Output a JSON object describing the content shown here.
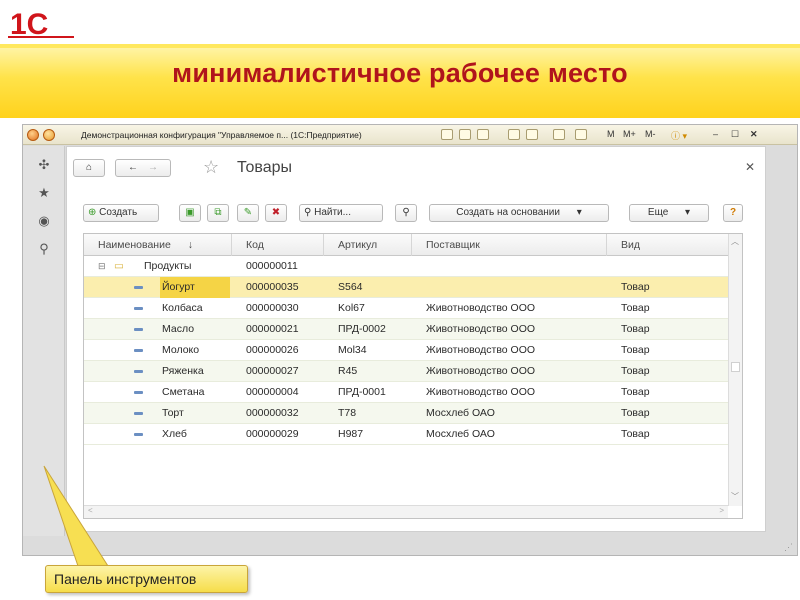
{
  "logo_text": "1С",
  "slide_title": "минималистичное рабочее место",
  "window": {
    "title": "Демонстрационная конфигурация \"Управляемое п... (1С:Предприятие)",
    "m_labels": [
      "M",
      "M+",
      "M-"
    ]
  },
  "form": {
    "title": "Товары",
    "toolbar": {
      "create": "Создать",
      "find": "Найти...",
      "create_based_on": "Создать на основании",
      "more": "Еще",
      "help": "?"
    }
  },
  "table": {
    "columns": [
      "Наименование",
      "Код",
      "Артикул",
      "Поставщик",
      "Вид"
    ],
    "sort_indicator": "↓",
    "group": {
      "name": "Продукты",
      "code": "000000011"
    },
    "rows": [
      {
        "name": "Йогурт",
        "code": "000000035",
        "article": "S564",
        "supplier": "",
        "kind": "Товар"
      },
      {
        "name": "Колбаса",
        "code": "000000030",
        "article": "Kol67",
        "supplier": "Животноводство ООО",
        "kind": "Товар"
      },
      {
        "name": "Масло",
        "code": "000000021",
        "article": "ПРД-0002",
        "supplier": "Животноводство ООО",
        "kind": "Товар"
      },
      {
        "name": "Молоко",
        "code": "000000026",
        "article": "Mol34",
        "supplier": "Животноводство ООО",
        "kind": "Товар"
      },
      {
        "name": "Ряженка",
        "code": "000000027",
        "article": "R45",
        "supplier": "Животноводство ООО",
        "kind": "Товар"
      },
      {
        "name": "Сметана",
        "code": "000000004",
        "article": "ПРД-0001",
        "supplier": "Животноводство ООО",
        "kind": "Товар"
      },
      {
        "name": "Торт",
        "code": "000000032",
        "article": "T78",
        "supplier": "Мосхлеб ОАО",
        "kind": "Товар"
      },
      {
        "name": "Хлеб",
        "code": "000000029",
        "article": "H987",
        "supplier": "Мосхлеб ОАО",
        "kind": "Товар"
      }
    ],
    "selected_row": 0
  },
  "callout": "Панель инструментов",
  "colors": {
    "title_red": "#b0141c",
    "band_yellow": "#ffd21c",
    "selected_row": "#fbeeae",
    "current_cell": "#f5d445",
    "callout_fill": "#f6dd4a"
  },
  "icons": [
    "menu-icon",
    "star-icon",
    "history-icon",
    "search-icon",
    "home-icon",
    "back-icon",
    "forward-icon",
    "add-icon",
    "copy-icon",
    "edit-icon",
    "delete-icon",
    "find-icon",
    "clear-find-icon",
    "dropdown-icon",
    "help-icon",
    "folder-icon",
    "expand-icon"
  ]
}
